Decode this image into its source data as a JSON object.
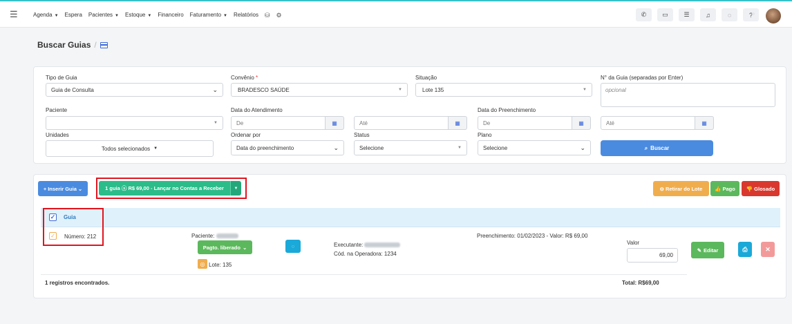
{
  "nav": {
    "menu": [
      {
        "label": "Agenda",
        "caret": true
      },
      {
        "label": "Espera",
        "caret": false
      },
      {
        "label": "Pacientes",
        "caret": true
      },
      {
        "label": "Estoque",
        "caret": true
      },
      {
        "label": "Financeiro",
        "caret": false
      },
      {
        "label": "Faturamento",
        "caret": true
      },
      {
        "label": "Relatórios",
        "caret": false
      }
    ],
    "extra_icons": [
      "database-icon",
      "gear-icon"
    ],
    "right_icons": [
      "phone-icon",
      "inbox-icon",
      "checklist-icon",
      "bell-icon",
      "chat-icon",
      "help-icon"
    ]
  },
  "page": {
    "title": "Buscar Guias",
    "separator": "/"
  },
  "filters": {
    "tipo_guia_label": "Tipo de Guia",
    "tipo_guia_value": "Guia de Consulta",
    "convenio_label": "Convênio",
    "convenio_required": "*",
    "convenio_value": "BRADESCO SAÚDE",
    "situacao_label": "Situação",
    "situacao_value": "Lote 135",
    "num_guia_label": "N° da Guia (separadas por Enter)",
    "num_guia_placeholder": "opcional",
    "paciente_label": "Paciente",
    "data_atend_label": "Data do Atendimento",
    "data_atend_de": "De",
    "data_atend_ate": "Até",
    "data_preench_label": "Data do Preenchimento",
    "data_preench_de": "De",
    "data_preench_ate": "Até",
    "unidades_label": "Unidades",
    "unidades_value": "Todos selecionados",
    "ordenar_label": "Ordenar por",
    "ordenar_value": "Data do preenchimento",
    "status_label": "Status",
    "status_value": "Selecione",
    "plano_label": "Plano",
    "plano_value": "Selecione",
    "buscar_label": "Buscar"
  },
  "actions": {
    "inserir_label": "Inserir Guia",
    "lancar_label": "1 guia ⓢ R$ 69,00 - Lançar no Contas a Receber",
    "retirar_label": "Retirar do Lote",
    "pago_label": "Pago",
    "glosado_label": "Glosado"
  },
  "table": {
    "header_label": "Guia",
    "row": {
      "numero": "Número: 212",
      "paciente_label": "Paciente:",
      "status_button": "Pagto. liberado",
      "lote": "Lote: 135",
      "executante_label": "Executante:",
      "cod_operadora": "Cód. na Operadora: 1234",
      "preenchimento": "Preenchimento: 01/02/2023 - Valor: R$ 69,00",
      "valor_label": "Valor",
      "valor_value": "69,00",
      "editar_label": "Editar"
    },
    "footer_count": "1 registros encontrados.",
    "footer_total": "Total: R$69,00"
  },
  "colors": {
    "accent": "#4a8be0",
    "teal_line": "#36c2c9",
    "green": "#5cb85c",
    "teal_button": "#2bbc8a",
    "orange": "#f0ad4e",
    "red": "#d9382f",
    "highlight": "#e0141e"
  }
}
